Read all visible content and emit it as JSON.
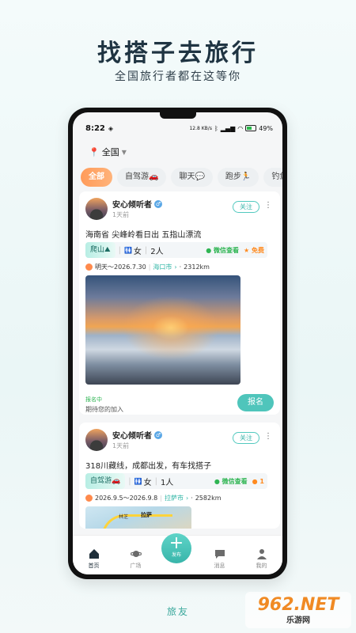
{
  "promo": {
    "title": "找搭子去旅行",
    "subtitle": "全国旅行者都在这等你",
    "footer": "旅友"
  },
  "status_bar": {
    "time": "8:22",
    "net_speed": "12.8 KB/s",
    "battery": "49%"
  },
  "location": {
    "label": "全国"
  },
  "tabs": [
    {
      "label": "全部",
      "active": true
    },
    {
      "label": "自驾游🚗",
      "active": false
    },
    {
      "label": "聊天💬",
      "active": false
    },
    {
      "label": "跑步🏃",
      "active": false
    },
    {
      "label": "钓鱼",
      "active": false
    }
  ],
  "posts": [
    {
      "username": "安心倾听者",
      "gender": "♂",
      "time_ago": "1天前",
      "follow_label": "关注",
      "description": "海南省 尖峰岭看日出 五指山漂流",
      "category": "爬山⛰",
      "gender_req": "女",
      "people": "2人",
      "contact": "微信查看",
      "fee": "免费",
      "dates": "明天～2026.7.30",
      "city": "海口市",
      "distance": "2312km",
      "enroll_status": "报名中",
      "enroll_hint": "期待您的加入",
      "enroll_button": "报名"
    },
    {
      "username": "安心倾听者",
      "gender": "♂",
      "time_ago": "1天前",
      "follow_label": "关注",
      "description": "318川藏线，成都出发，有车找搭子",
      "category": "自驾游🚗",
      "gender_req": "女",
      "people": "1人",
      "contact": "微信查看",
      "fee": "1",
      "dates": "2026.9.5～2026.9.8",
      "city": "拉萨市",
      "distance": "2582km",
      "map_label_main": "拉萨",
      "map_label_side": "林芝"
    }
  ],
  "bottom_nav": [
    {
      "label": "首页",
      "icon": "home-icon",
      "active": true
    },
    {
      "label": "广场",
      "icon": "planet-icon",
      "active": false
    },
    {
      "label": "发布",
      "icon": "plus-icon",
      "active": false
    },
    {
      "label": "消息",
      "icon": "chat-bubble-icon",
      "active": false
    },
    {
      "label": "我的",
      "icon": "user-icon",
      "active": false
    }
  ],
  "watermark": {
    "main": "962.NET",
    "sub": "乐游网"
  }
}
